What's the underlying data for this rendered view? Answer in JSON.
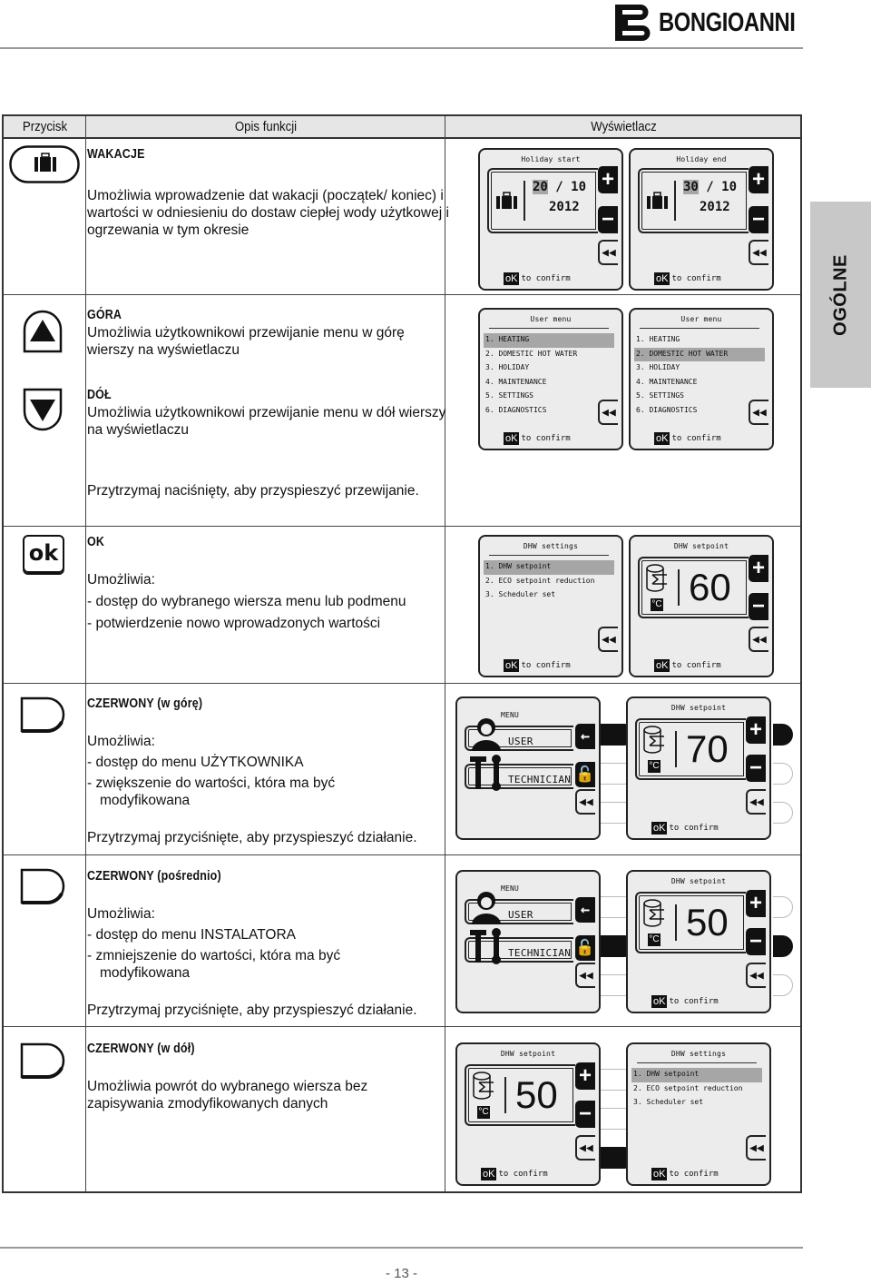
{
  "brand": {
    "name": "BONGIOANNI"
  },
  "table": {
    "headers": {
      "button": "Przycisk",
      "description": "Opis funkcji",
      "display": "Wyświetlacz"
    }
  },
  "rows": {
    "holiday": {
      "icon": "suitcase-button-icon",
      "title": "WAKACJE",
      "text": "Umożliwia wprowadzenie dat wakacji (początek/ koniec) i wartości w odniesieniu do dostaw ciepłej wody użytkowej i ogrzewania w tym okresie",
      "screens": [
        {
          "title": "Holiday start",
          "day": "20",
          "month": "10",
          "year": "2012",
          "confirm": "to confirm",
          "ok": "oK"
        },
        {
          "title": "Holiday end",
          "day": "30",
          "month": "10",
          "year": "2012",
          "confirm": "to confirm",
          "ok": "oK"
        }
      ]
    },
    "updown": {
      "up_title": "GÓRA",
      "up_text": "Umożliwia użytkownikowi przewijanie menu w górę wierszy na wyświetlaczu",
      "down_title": "DÓŁ",
      "down_text": "Umożliwia użytkownikowi przewijanie menu w dół wierszy na wyświetlaczu",
      "hold_text": "Przytrzymaj naciśnięty, aby przyspieszyć przewijanie.",
      "screens": [
        {
          "title": "User menu",
          "items": [
            "1. HEATING",
            "2. DOMESTIC HOT WATER",
            "3. HOLIDAY",
            "4. MAINTENANCE",
            "5. SETTINGS",
            "6. DIAGNOSTICS"
          ],
          "selected": 0,
          "confirm": "to confirm",
          "ok": "oK"
        },
        {
          "title": "User menu",
          "items": [
            "1. HEATING",
            "2. DOMESTIC HOT WATER",
            "3. HOLIDAY",
            "4. MAINTENANCE",
            "5. SETTINGS",
            "6. DIAGNOSTICS"
          ],
          "selected": 1,
          "confirm": "to confirm",
          "ok": "oK"
        }
      ]
    },
    "ok": {
      "button_label": "ok",
      "title": "OK",
      "intro": "Umożliwia:",
      "bullets": [
        "- dostęp do wybranego wiersza menu lub podmenu",
        "- potwierdzenie nowo wprowadzonych wartości"
      ],
      "screen_menu": {
        "title": "DHW settings",
        "items": [
          "1. DHW setpoint",
          "2. ECO setpoint reduction",
          "3. Scheduler set"
        ],
        "selected": 0,
        "confirm": "to confirm",
        "ok": "oK"
      },
      "screen_value": {
        "title": "DHW setpoint",
        "value": "60",
        "unit": "°C",
        "confirm": "to confirm",
        "ok": "oK"
      }
    },
    "red_up": {
      "title": "CZERWONY (w górę)",
      "intro": "Umożliwia:",
      "bullets": [
        "- dostęp do menu UŻYTKOWNIKA",
        "- zwiększenie do wartości, która ma być modyfikowana"
      ],
      "hold_text": "Przytrzymaj przyciśnięte, aby przyspieszyć działanie.",
      "screen_menu": {
        "title": "MENU",
        "user": "USER",
        "technician": "TECHNICIAN",
        "active": 0
      },
      "screen_value": {
        "title": "DHW setpoint",
        "value": "70",
        "unit": "°C",
        "confirm": "to confirm",
        "ok": "oK",
        "active": 0
      }
    },
    "red_mid": {
      "title": "CZERWONY (pośrednio)",
      "intro": "Umożliwia:",
      "bullets": [
        "- dostęp do menu INSTALATORA",
        "- zmniejszenie do wartości, która ma być modyfikowana"
      ],
      "hold_text": "Przytrzymaj przyciśnięte, aby przyspieszyć działanie.",
      "screen_menu": {
        "title": "MENU",
        "user": "USER",
        "technician": "TECHNICIAN",
        "active": 1
      },
      "screen_value": {
        "title": "DHW setpoint",
        "value": "50",
        "unit": "°C",
        "confirm": "to confirm",
        "ok": "oK",
        "active": 1
      }
    },
    "red_down": {
      "title": "CZERWONY (w dół)",
      "text": "Umożliwia powrót do wybranego wiersza bez zapisywania zmodyfikowanych danych",
      "screen_value": {
        "title": "DHW setpoint",
        "value": "50",
        "unit": "°C",
        "confirm": "to confirm",
        "ok": "oK",
        "active": 2
      },
      "screen_menu": {
        "title": "DHW settings",
        "items": [
          "1. DHW setpoint",
          "2. ECO setpoint reduction",
          "3. Scheduler set"
        ],
        "selected": 0,
        "confirm": "to confirm",
        "ok": "oK"
      }
    }
  },
  "side_tab": "OGÓLNE",
  "page_number": "- 13 -"
}
